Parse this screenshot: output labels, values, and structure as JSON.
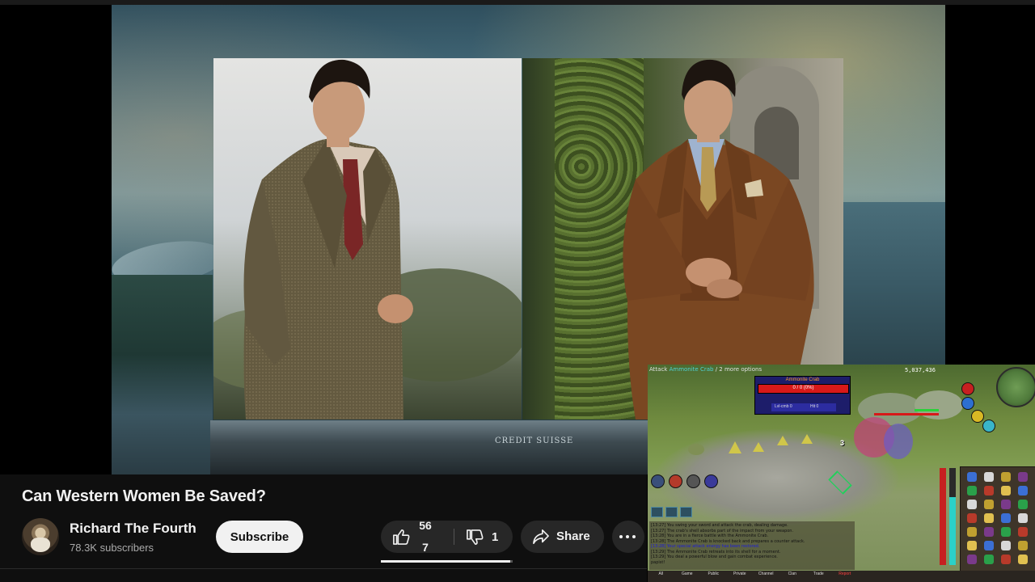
{
  "video": {
    "title": "Can Western Women Be Saved?",
    "background_sign": "CREDIT SUISSE"
  },
  "channel": {
    "name": "Richard The Fourth",
    "subscribers": "78.3K subscribers",
    "subscribe_label": "Subscribe"
  },
  "actions": {
    "like_count_top": "56",
    "like_count_bottom": "7",
    "dislike_count": "1",
    "share_label": "Share",
    "like_ratio": 0.98
  },
  "game": {
    "hover_text": "Attack",
    "hover_target": "Ammonite Crab",
    "hover_suffix": "/ 2 more options",
    "xp_counter": "5,037,436",
    "npc": {
      "name": "Ammonite Crab",
      "hp_text": "0 / 0 (0%)",
      "sub_left": "Lvl-cmb 0",
      "sub_right": "Hit 0"
    },
    "chat_tabs": [
      "All",
      "Game",
      "Public",
      "Private",
      "Channel",
      "Clan",
      "Trade",
      "Report"
    ],
    "chat_lines": [
      {
        "text": "[13:27] You swing your sword and attack the crab, dealing damage.",
        "style": "dark"
      },
      {
        "text": "[13:27] The crab's shell absorbs part of the impact from your weapon.",
        "style": "dark"
      },
      {
        "text": "[13:28] You are in a fierce battle with the Ammonite Crab.",
        "style": "dark"
      },
      {
        "text": "[13:28] The Ammonite Crab is knocked back and prepares a counter attack.",
        "style": "dark"
      },
      {
        "text": "[13:28] Your special attack energy has been restored.",
        "style": "blue"
      },
      {
        "text": "[13:29] The Ammonite Crab retreats into its shell for a moment.",
        "style": "dark"
      },
      {
        "text": "[13:29] You deal a powerful blow and gain combat experience.",
        "style": "dark"
      },
      {
        "text": "papist!",
        "style": "dark"
      }
    ],
    "colors": {
      "npc_hp": "#d81919",
      "hp_orb": "#c62020",
      "prayer_orb": "#2d6fd0",
      "run_orb": "#d9b824",
      "spec_orb": "#39b5c9"
    }
  }
}
